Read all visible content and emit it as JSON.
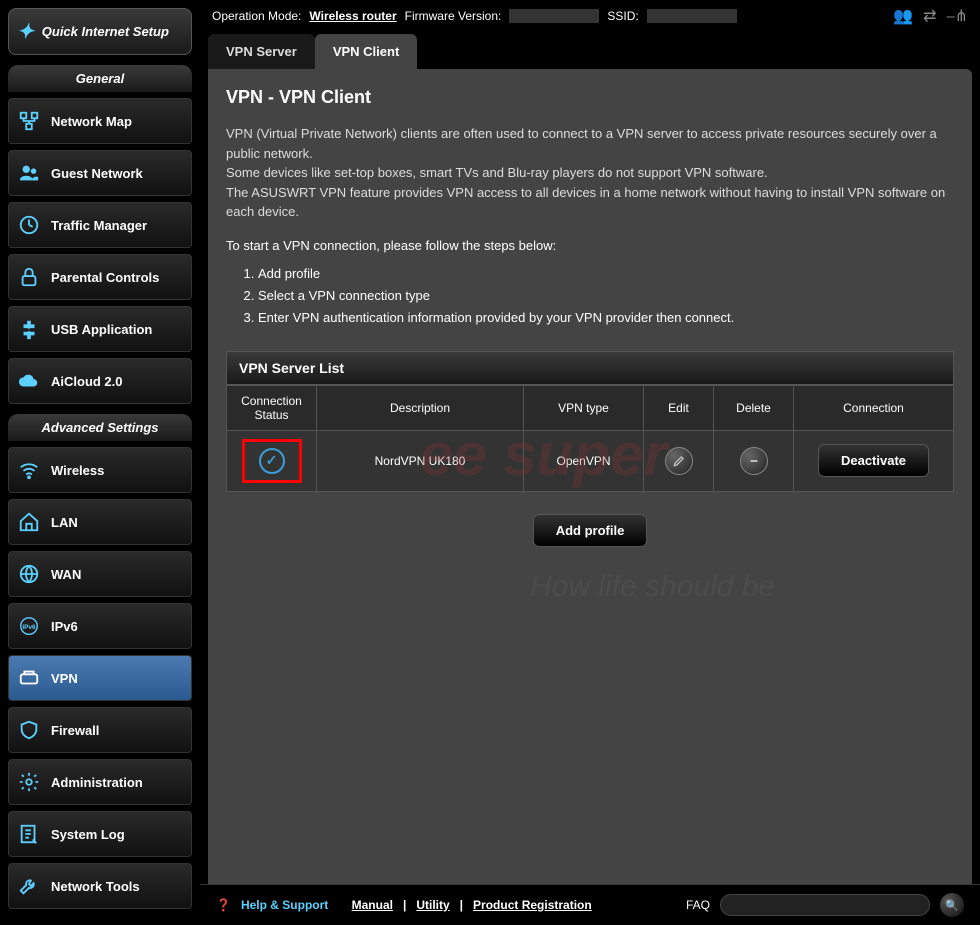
{
  "quickSetup": {
    "label": "Quick Internet Setup"
  },
  "sections": {
    "general": {
      "title": "General",
      "items": [
        {
          "label": "Network Map",
          "icon": "network-map"
        },
        {
          "label": "Guest Network",
          "icon": "guest"
        },
        {
          "label": "Traffic Manager",
          "icon": "traffic"
        },
        {
          "label": "Parental Controls",
          "icon": "lock"
        },
        {
          "label": "USB Application",
          "icon": "puzzle"
        },
        {
          "label": "AiCloud 2.0",
          "icon": "cloud"
        }
      ]
    },
    "advanced": {
      "title": "Advanced Settings",
      "items": [
        {
          "label": "Wireless",
          "icon": "wifi"
        },
        {
          "label": "LAN",
          "icon": "home"
        },
        {
          "label": "WAN",
          "icon": "globe"
        },
        {
          "label": "IPv6",
          "icon": "ipv6"
        },
        {
          "label": "VPN",
          "icon": "vpn",
          "active": true
        },
        {
          "label": "Firewall",
          "icon": "shield"
        },
        {
          "label": "Administration",
          "icon": "gear"
        },
        {
          "label": "System Log",
          "icon": "log"
        },
        {
          "label": "Network Tools",
          "icon": "wrench"
        }
      ]
    }
  },
  "topbar": {
    "opModeLabel": "Operation Mode:",
    "opMode": "Wireless router",
    "fwLabel": "Firmware Version:",
    "ssidLabel": "SSID:"
  },
  "tabs": [
    {
      "label": "VPN Server",
      "active": false
    },
    {
      "label": "VPN Client",
      "active": true
    }
  ],
  "page": {
    "title": "VPN - VPN Client",
    "desc1": "VPN (Virtual Private Network) clients are often used to connect to a VPN server to access private resources securely over a public network.",
    "desc2": "Some devices like set-top boxes, smart TVs and Blu-ray players do not support VPN software.",
    "desc3": "The ASUSWRT VPN feature provides VPN access to all devices in a home network without having to install VPN software on each device.",
    "stepsIntro": "To start a VPN connection, please follow the steps below:",
    "steps": [
      "Add profile",
      "Select a VPN connection type",
      "Enter VPN authentication information provided by your VPN provider then connect."
    ]
  },
  "table": {
    "title": "VPN Server List",
    "headers": {
      "status": "Connection Status",
      "desc": "Description",
      "type": "VPN type",
      "edit": "Edit",
      "delete": "Delete",
      "conn": "Connection"
    },
    "rows": [
      {
        "status": "connected",
        "desc": "NordVPN UK180",
        "type": "OpenVPN",
        "connLabel": "Deactivate"
      }
    ],
    "addLabel": "Add profile"
  },
  "footer": {
    "help": "Help & Support",
    "manual": "Manual",
    "utility": "Utility",
    "product": "Product Registration",
    "faq": "FAQ"
  }
}
